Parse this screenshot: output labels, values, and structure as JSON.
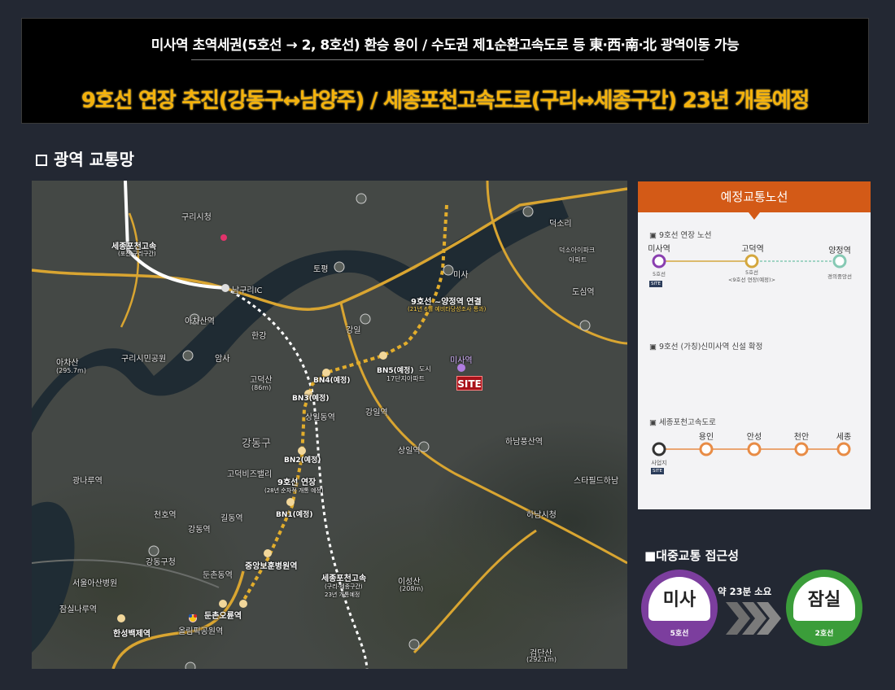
{
  "banner": {
    "line1": "미사역 초역세권(5호선 → 2, 8호선) 환승 용이 / 수도권 제1순환고속도로 등 東‧西‧南‧北 광역이동 가능",
    "line2": "9호선 연장 추진(강동구↔남양주) / 세종포천고속도로(구리↔세종구간) 23년 개통예정"
  },
  "section_title": "광역 교통망",
  "map": {
    "site_label": "SITE",
    "labels": {
      "guri_cityhall": "구리시청",
      "sejong_highway_top": "세종포천고속",
      "sejong_highway_top_sub": "(포천-구리구간)",
      "namguri_ic": "남구리IC",
      "tolwon": "토평",
      "achasan": "아차산",
      "achasan_height": "(295.7m)",
      "guri_park": "구리시민공원",
      "amsa": "암사",
      "godeoksan": "고덕산",
      "godeoksan_height": "(86m)",
      "gangil": "강일",
      "misa_ic": "미사",
      "line9_ext_top": "9호선 ~양정역 연결",
      "line9_ext_top_sub": "(21년 6월 예비타당성조사 통과)",
      "bn5": "BN5(예정)",
      "bn5_sub": "도시",
      "apt17": "17단지아파트",
      "misa_station": "미사역",
      "bn4": "BN4(예정)",
      "bn3": "BN3(예정)",
      "sangil": "상일동역",
      "gangiljeon": "강일역",
      "gangdonggu": "강동구",
      "bn2": "BN2(예정)",
      "sangyeok": "상일역",
      "line9_ext": "9호선 연장",
      "line9_ext_sub": "(28년 순차적 개통 예정)",
      "bn1": "BN1(예정)",
      "godeok_interchange": "고덕비즈밸리",
      "gildong": "길동역",
      "cheonho": "천호역",
      "gangdong": "강동역",
      "gangdong_gu_office": "강동구청",
      "jungang_hospital": "중앙보훈병원역",
      "dunchon": "둔촌동역",
      "dunchon_oryun": "둔촌오륜역",
      "olympic_park": "올림픽공원역",
      "hansung": "한성백제역",
      "sejong_highway_bottom": "세종포천고속",
      "sejong_highway_bottom_sub": "(구리-세종구간)",
      "sejong_highway_bottom_sub2": "23년 개통예정",
      "iseongsan": "이성산",
      "iseongsan_height": "(208m)",
      "hanam_station": "하남시청",
      "hanam_pungsan": "하남풍산역",
      "starfield": "스타필드하남",
      "geomdan": "검단산",
      "geomdan_height": "(292.1m)",
      "seoul_asan": "서울아산병원",
      "jamsil_naru": "잠실나루역",
      "deokso": "덕소리",
      "dosim": "도심역",
      "hanriver": "한강",
      "achasan_station": "아차산역",
      "gwangnaru": "광나루역",
      "yangjeong_park": "덕소아이파크",
      "yangjeong_park2": "아파트"
    }
  },
  "panel": {
    "header": "예정교통노선",
    "section1": {
      "title": "▣ 9호선  연장 노선",
      "stations": [
        "미사역",
        "고덕역",
        "양정역"
      ],
      "subs": [
        "5호선",
        "5호선\n<9호선 연장(예정)>",
        "경의중앙선"
      ],
      "chip": "SITE",
      "colors": {
        "misa": "#8a3fb0",
        "godeok": "#d4a73e",
        "yangjeong": "#86c9b4",
        "line": "#d4a73e"
      }
    },
    "section2": {
      "title": "▣ 9호선 (가칭)신미사역 신설 확정"
    },
    "section3": {
      "title": "▣ 세종포천고속도로",
      "stations": [
        "용인",
        "안성",
        "천안",
        "세종"
      ],
      "origin_label": "사업지",
      "chip": "SITE",
      "colors": {
        "origin": "#333333",
        "stops": "#e88c46"
      }
    }
  },
  "access": {
    "title": "■대중교통 접근성",
    "from": {
      "name": "미사",
      "line": "5호선",
      "color": "#7c3e9e"
    },
    "to": {
      "name": "잠실",
      "line": "2호선",
      "color": "#3b9d3a"
    },
    "time": "약 23분 소요"
  }
}
